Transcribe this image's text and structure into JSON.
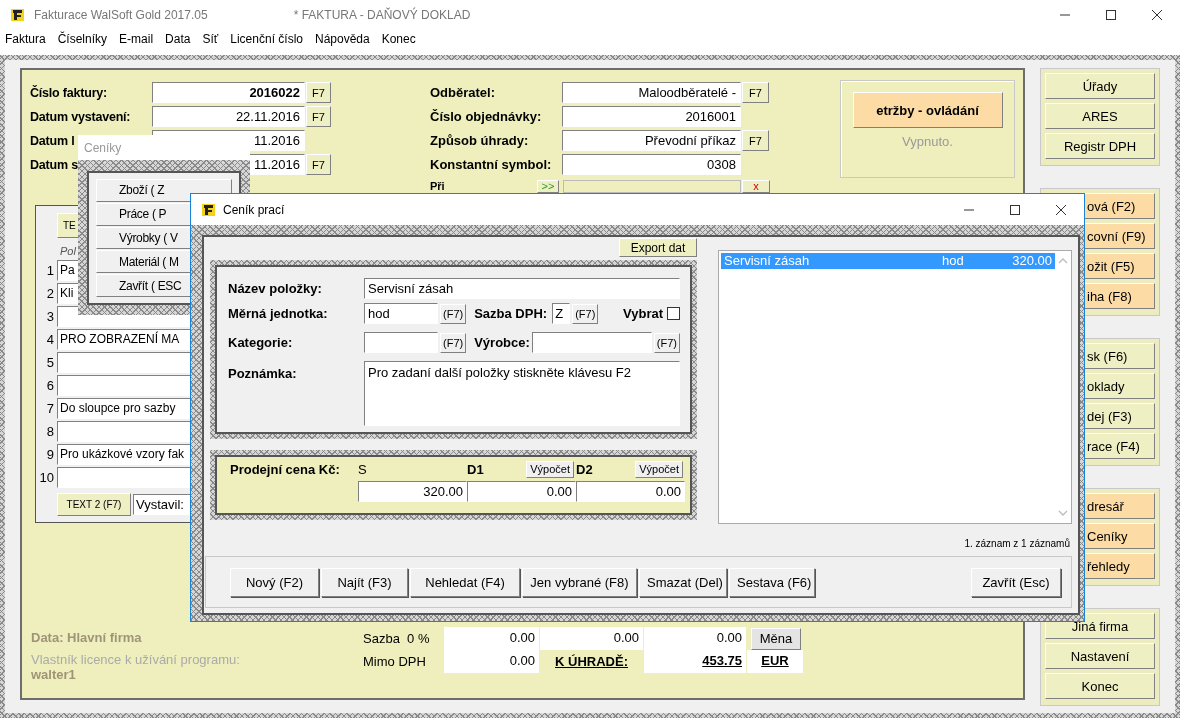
{
  "window": {
    "title": "Fakturace WalSoft Gold 2017.05",
    "document": "*  FAKTURA - DAŇOVÝ DOKLAD"
  },
  "menu": [
    "Faktura",
    "Číselníky",
    "E-mail",
    "Data",
    "Síť",
    "Licenční číslo",
    "Nápověda",
    "Konec"
  ],
  "invoice_fields": [
    {
      "label": "Číslo faktury:",
      "value": "2016022",
      "bold": true,
      "button": "F7"
    },
    {
      "label": "Datum vystavení:",
      "value": "22.11.2016",
      "bold": false,
      "button": "F7"
    },
    {
      "label": "Datum l",
      "value": "11.2016",
      "bold": false
    },
    {
      "label": "Datum s",
      "value": "11.2016",
      "bold": false,
      "button": "F7"
    }
  ],
  "customer_fields": [
    {
      "label": "Odběratel:",
      "value": "Maloodběratelé -",
      "button": "F7"
    },
    {
      "label": "Číslo objednávky:",
      "value": "2016001"
    },
    {
      "label": "Způsob úhrady:",
      "value": "Převodní příkaz",
      "button": "F7"
    },
    {
      "label": "Konstantní symbol:",
      "value": "0308"
    }
  ],
  "note_row": {
    "label": "Při",
    "add_button": ">>",
    "clear_button": "x"
  },
  "eet": {
    "button": "etržby - ovládání",
    "status": "Vypnuto."
  },
  "items": {
    "text_button": "TE",
    "column_header": "Pol",
    "rows": [
      {
        "number": "1",
        "text": "Pa"
      },
      {
        "number": "2",
        "text": "Kli"
      },
      {
        "number": "3"
      },
      {
        "number": "4",
        "text": "PRO ZOBRAZENÍ MA"
      },
      {
        "number": "5"
      },
      {
        "number": "6"
      },
      {
        "number": "7",
        "text": "Do sloupce pro sazby"
      },
      {
        "number": "8"
      },
      {
        "number": "9",
        "text": "Pro ukázkové vzory fak"
      },
      {
        "number": "10"
      }
    ],
    "text2_button": "TEXT 2 (F7)",
    "issuer": "Vystavil:"
  },
  "summary": {
    "company": "Data: Hlavní firma",
    "license_label": "Vlastník licence k užívání programu:",
    "licensee": "walter1",
    "vat_label": "Sazba  0 %",
    "vat_values": [
      "0.00",
      "0.00",
      "0.00"
    ],
    "currency_button": "Měna",
    "net_label": "Mimo DPH",
    "net_value": "0.00",
    "total_label": "K ÚHRADĚ:",
    "total": "453.75",
    "currency": "EUR"
  },
  "side_groups": [
    {
      "highlighted": false,
      "covered": false,
      "buttons": [
        "Úřady",
        "ARES",
        "Registr DPH"
      ]
    },
    {
      "highlighted": true,
      "covered": true,
      "buttons": [
        "ová (F2)",
        "covní (F9)",
        "ožit (F5)",
        "iha (F8)"
      ]
    },
    {
      "highlighted": false,
      "covered": true,
      "buttons": [
        "sk (F6)",
        "oklady",
        "dej (F3)",
        "race (F4)"
      ]
    },
    {
      "highlighted": true,
      "covered": true,
      "buttons": [
        "dresář",
        "Ceníky",
        "řehledy"
      ]
    },
    {
      "highlighted": false,
      "covered": false,
      "buttons": [
        "Jiná firma",
        "Nastavení",
        "Konec"
      ]
    }
  ],
  "price_lists_dialog": {
    "title": "Ceníky",
    "buttons": [
      "Zboží ( Z",
      "Práce ( P",
      "Výrobky ( V",
      "Materiál ( M",
      "Zavřít ( ESC"
    ]
  },
  "dialog": {
    "title": "Ceník prací",
    "export_button": "Export dat",
    "name_label": "Název položky:",
    "name": "Servisní zásah",
    "unit_label": "Měrná jednotka:",
    "unit": "hod",
    "unit_button": "(F7)",
    "vat_label": "Sazba DPH:",
    "vat": "Z",
    "vat_button": "(F7)",
    "select_label": "Vybrat",
    "select_checked": false,
    "category_label": "Kategorie:",
    "category_button": "(F7)",
    "maker_label": "Výrobce:",
    "maker_button": "(F7)",
    "note_label": "Poznámka:",
    "note": "Pro zadaní další položky stiskněte klávesu F2",
    "price_label": "Prodejní cena Kč:",
    "price_columns": [
      {
        "heading": "S",
        "value": "320.00"
      },
      {
        "heading": "D1",
        "button": "Výpočet",
        "value": "0.00"
      },
      {
        "heading": "D2",
        "button": "Výpočet",
        "value": "0.00"
      }
    ],
    "list_rows": [
      {
        "name": "Servisní zásah",
        "unit": "hod",
        "price": "320.00",
        "selected": true
      }
    ],
    "record": "1. záznam z 1 záznamů",
    "buttons": [
      "Nový (F2)",
      "Najít (F3)",
      "Nehledat (F4)",
      "Jen vybrané (F8)",
      "Smazat (Del)",
      "Sestava (F6)"
    ],
    "close_button": "Zavřít (Esc)"
  }
}
